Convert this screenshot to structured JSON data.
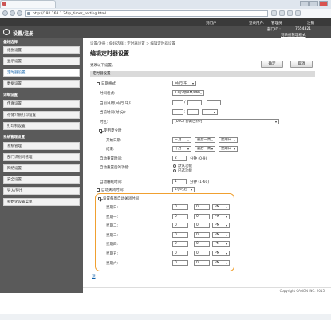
{
  "browser": {
    "url": "http://192.168.1.24/p_timer_setting.html"
  },
  "topbar": {
    "links": [
      "到门户",
      "登录用户:",
      "管理员",
      "注销"
    ]
  },
  "header": {
    "title": "设置/注册",
    "dept_label": "部门ID :",
    "dept_id": "7654321",
    "link": "到系统管理模式"
  },
  "sidebar": {
    "groups": [
      {
        "heading": "偏好选择",
        "items": [
          "纸张设置",
          "显示设置",
          "定时器设置",
          "数据设置"
        ],
        "active": "定时器设置"
      },
      {
        "heading": "详细设置",
        "items": [
          "传真设置",
          "存储介质打印设置",
          "打印机设置"
        ]
      },
      {
        "heading": "系统管理设置",
        "items": [
          "系统管理",
          "部门识别码管理",
          "网络设置",
          "安全设置",
          "导入/导出",
          "初始化设置菜单"
        ]
      }
    ]
  },
  "main": {
    "breadcrumb": "设置/注册 : 偏好选择 : 定时器设置 > 编辑定时器设置",
    "title": "编辑定时器设置",
    "description": "更改以下设置。",
    "ok": "确定",
    "cancel": "取消",
    "section": "定时器设置",
    "date_format_label": "日期格式:",
    "date_format_value": "日/月 年",
    "time_format_label": "时间格式:",
    "time_format_value": "12小时(AM/PM)",
    "current_date_label": "当前日期(日/月 年):",
    "current_time_label": "当前时间(时:分):",
    "timezone_label": "时区:",
    "timezone_value": "(UTC) 协调世界时",
    "dst_label": "使用夏令时",
    "dst_start_label": "开始日期:",
    "dst_start": [
      "三月",
      "最后一周",
      "星期日"
    ],
    "dst_end_label": "结束:",
    "dst_end": [
      "十月",
      "最后一周",
      "星期日"
    ],
    "auto_reset_label": "自动重置时间:",
    "auto_reset_value": "2",
    "auto_reset_unit": "分钟 (0-9)",
    "after_reset_label": "自动重置后的功能:",
    "after_reset_opt1": "默认功能",
    "after_reset_opt2": "已选功能",
    "auto_sleep_label": "自动睡眠时间:",
    "auto_sleep_value": "1",
    "auto_sleep_unit": "分钟 (1-60)",
    "auto_off_label": "自动关闭时间:",
    "auto_off_value": "4小时后",
    "auto_off_checkbox_label": "设置每周自动关闭时间",
    "weekdays": [
      "星期日:",
      "星期一:",
      "星期二:",
      "星期三:",
      "星期四:",
      "星期五:",
      "星期六:"
    ],
    "weekday_hour": "0",
    "weekday_min": "0",
    "weekday_ampm": "PM",
    "top_link": "顶"
  },
  "footer": {
    "copyright": "Copyright CANON INC. 2015"
  }
}
